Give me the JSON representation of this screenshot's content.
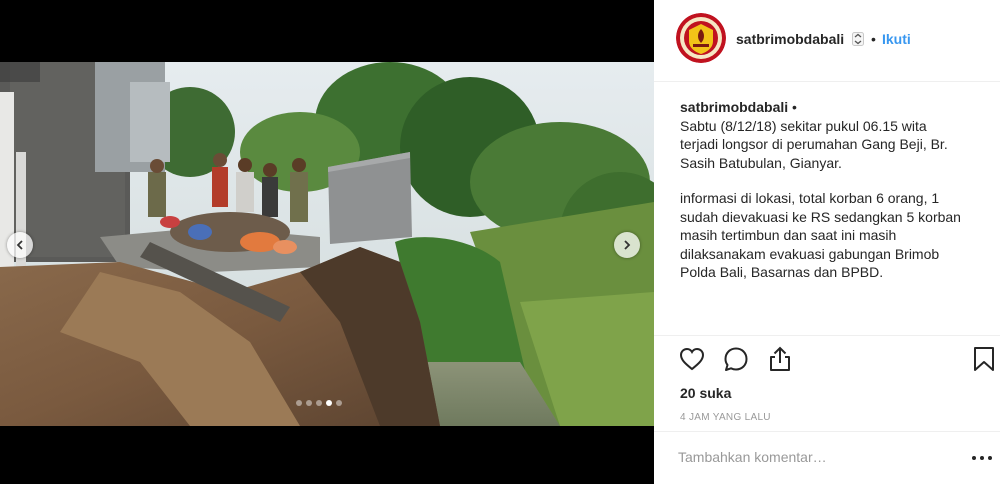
{
  "post": {
    "username": "satbrimobdabali",
    "separator": "•",
    "follow_label": "Ikuti",
    "caption_username": "satbrimobdabali",
    "caption_separator": " •",
    "caption_paragraph_1": "Sabtu (8/12/18) sekitar pukul 06.15 wita\nterjadi longsor di perumahan Gang Beji, Br.\nSasih Batubulan, Gianyar.",
    "caption_paragraph_2": "informasi di lokasi, total korban 6 orang, 1\nsudah dievakuasi ke RS sedangkan 5 korban\nmasih tertimbun dan saat ini masih\ndilaksanakam evakuasi gabungan Brimob\nPolda Bali, Basarnas dan BPBD.",
    "likes": "20 suka",
    "timestamp": "4 JAM YANG LALU"
  },
  "comment": {
    "placeholder": "Tambahkan komentar…"
  },
  "carousel": {
    "slide_count": 5,
    "active_index": 3
  },
  "icons": {
    "prev": "chevron-left-icon",
    "next": "chevron-right-icon",
    "like": "heart-icon",
    "comment": "comment-icon",
    "share": "share-icon",
    "save": "bookmark-icon",
    "more": "more-options-icon",
    "verified": "verified-icon"
  },
  "colors": {
    "link": "#3897f0",
    "text": "#262626",
    "muted": "#999999",
    "border": "#efefef",
    "avatar_ring": "#c0121f",
    "avatar_fill": "#f2c318"
  }
}
